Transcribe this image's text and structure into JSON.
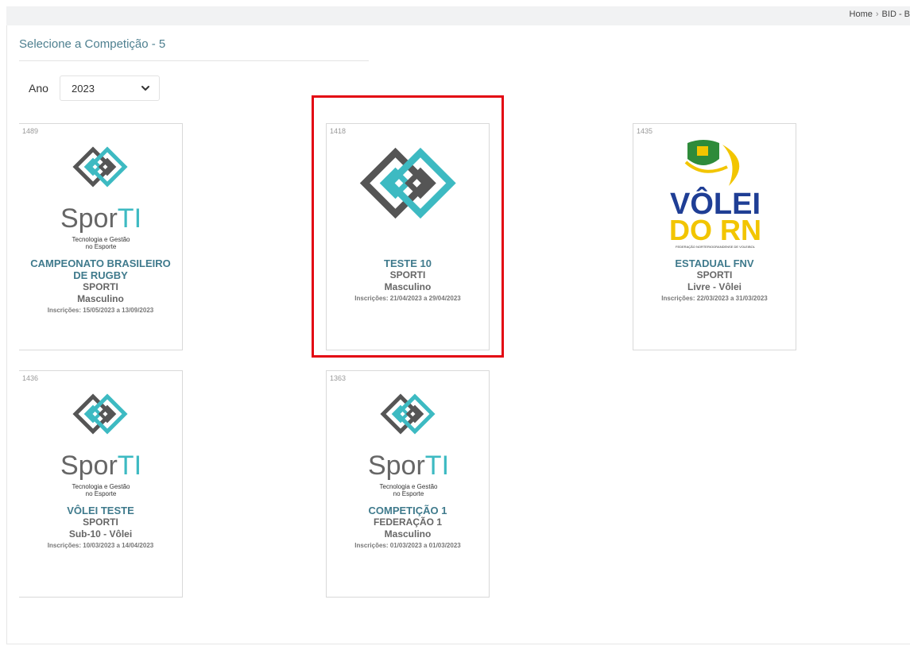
{
  "breadcrumb": {
    "home": "Home",
    "current": "BID - B"
  },
  "page": {
    "title": "Selecione a Competição - 5"
  },
  "filter": {
    "label": "Ano",
    "selected": "2023"
  },
  "competitions": [
    {
      "id": "1489",
      "name": "CAMPEONATO BRASILEIRO DE RUGBY",
      "org": "SPORTI",
      "category": "Masculino",
      "dates": "Inscrições: 15/05/2023 a 13/09/2023",
      "logo": {
        "type": "sporti",
        "text1": "Spor",
        "text2": "TI",
        "tagline1": "Tecnologia e Gestão",
        "tagline2": "no Esporte"
      }
    },
    {
      "id": "1418",
      "name": "TESTE 10",
      "org": "SPORTI",
      "category": "Masculino",
      "dates": "Inscrições: 21/04/2023 a 29/04/2023",
      "logo": {
        "type": "sporti-icon"
      }
    },
    {
      "id": "1435",
      "name": "ESTADUAL FNV",
      "org": "SPORTI",
      "category": "Livre - Vôlei",
      "dates": "Inscrições: 22/03/2023 a 31/03/2023",
      "logo": {
        "type": "volei-rn",
        "text1": "VÔLEI",
        "text2": "DO RN",
        "caption": "FEDERAÇÃO NORTERIOGRANDENSE DE VOLEIBOL"
      }
    },
    {
      "id": "1436",
      "name": "VÔLEI TESTE",
      "org": "SPORTI",
      "category": "Sub-10 - Vôlei",
      "dates": "Inscrições: 10/03/2023 a 14/04/2023",
      "logo": {
        "type": "sporti",
        "text1": "Spor",
        "text2": "TI",
        "tagline1": "Tecnologia e Gestão",
        "tagline2": "no Esporte"
      }
    },
    {
      "id": "1363",
      "name": "COMPETIÇÃO 1",
      "org": "FEDERAÇÃO 1",
      "category": "Masculino",
      "dates": "Inscrições: 01/03/2023 a 01/03/2023",
      "logo": {
        "type": "sporti",
        "text1": "Spor",
        "text2": "TI",
        "tagline1": "Tecnologia e Gestão",
        "tagline2": "no Esporte"
      }
    }
  ],
  "colors": {
    "teal": "#3dbac2",
    "dark_gray": "#555555",
    "title_teal": "#3f7a8c",
    "highlight": "#e30613",
    "rn_blue": "#1f3e95",
    "rn_yellow": "#f2c500"
  },
  "icons": {
    "select_chevron": "chevron-down-icon",
    "breadcrumb_separator": "chevron-right-icon"
  }
}
